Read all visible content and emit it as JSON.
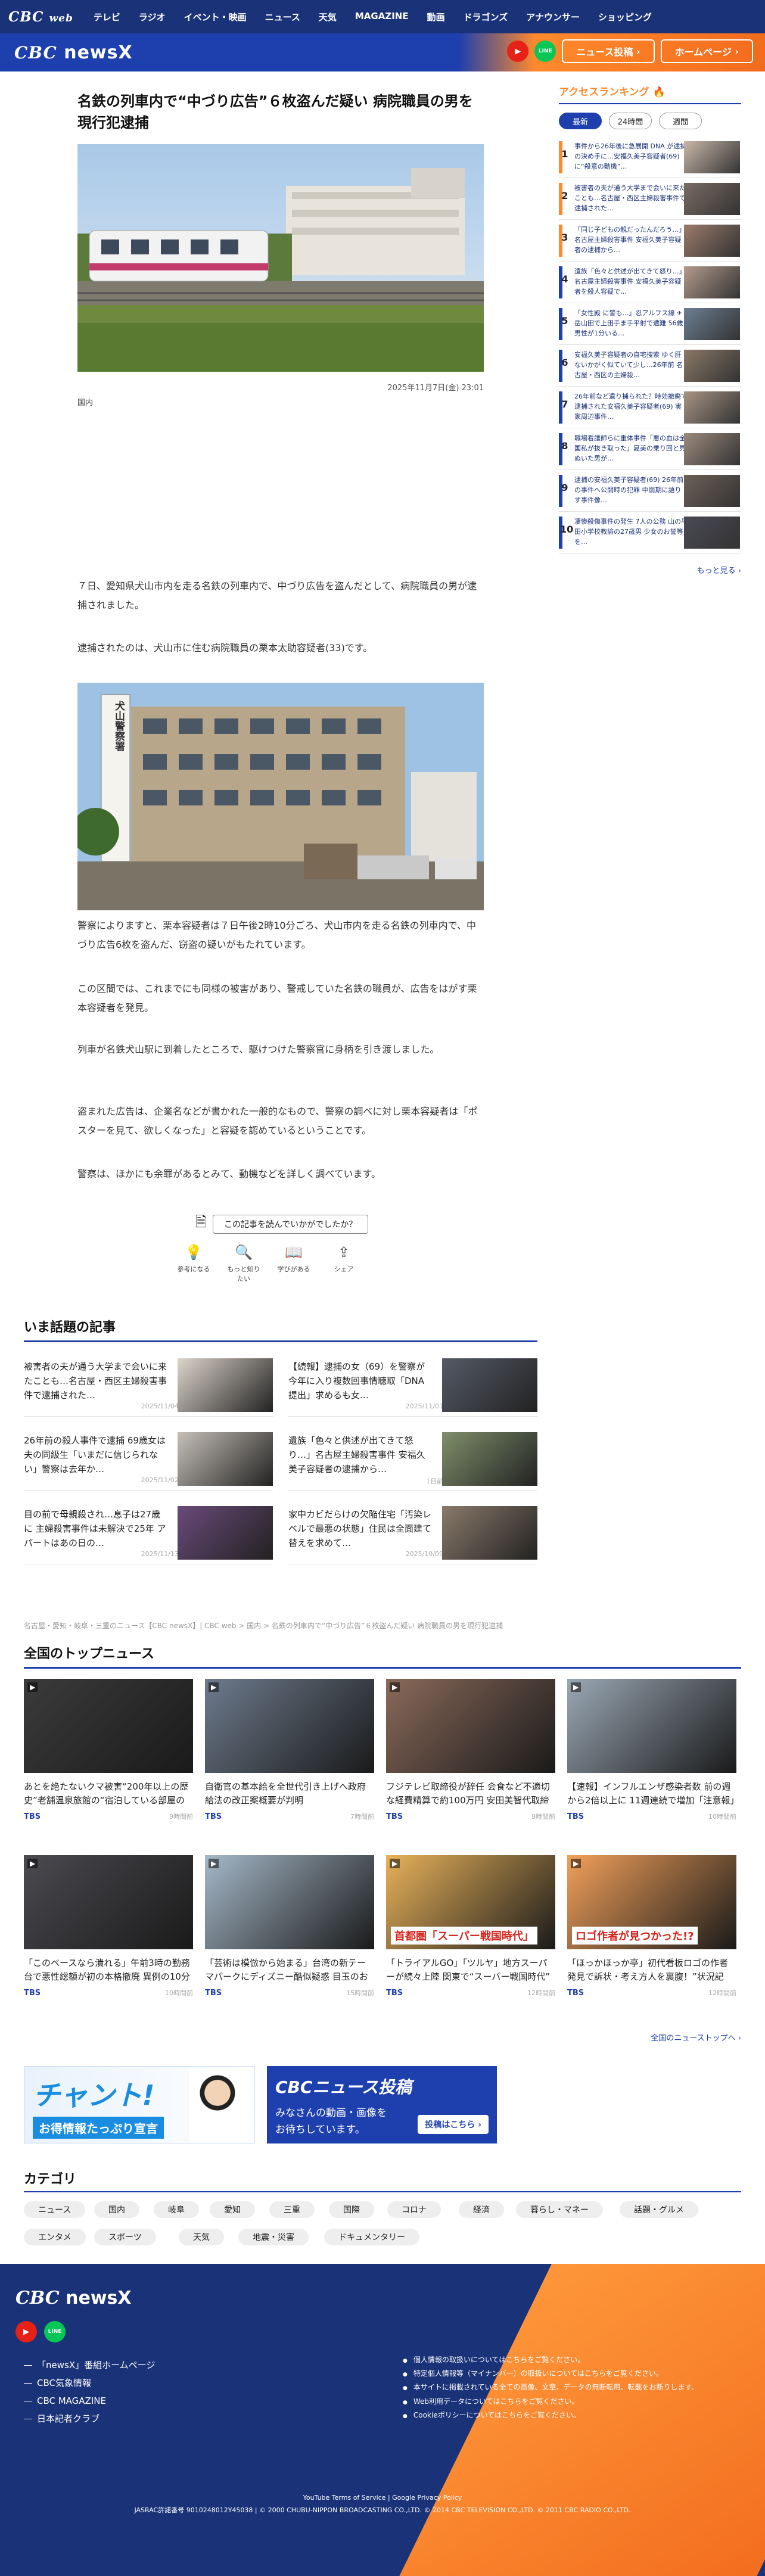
{
  "topnav": {
    "logo": "CBC",
    "logo_sub": "web",
    "items": [
      "テレビ",
      "ラジオ",
      "イベント・映画",
      "ニュース",
      "天気",
      "MAGAZINE",
      "動画",
      "ドラゴンズ",
      "アナウンサー",
      "ショッピング"
    ]
  },
  "brandbar": {
    "logo_a": "CBC",
    "logo_b": "newsX",
    "youtube": "▶",
    "line": "LINE",
    "post": "ニュース投稿",
    "home": "ホームページ"
  },
  "article": {
    "title": "名鉄の列車内で“中づり広告”６枚盗んだ疑い 病院職員の男を現行犯逮捕",
    "date": "2025年11月7日(金) 23:01",
    "category": "国内",
    "p1": "７日、愛知県犬山市内を走る名鉄の列車内で、中づり広告を盗んだとして、病院職員の男が逮捕されました。",
    "p2": "逮捕されたのは、犬山市に住む病院職員の栗本太助容疑者(33)です。",
    "p3": "警察によりますと、栗本容疑者は７日午後2時10分ごろ、犬山市内を走る名鉄の列車内で、中づり広告6枚を盗んだ、窃盗の疑いがもたれています。",
    "p4": "この区間では、これまでにも同様の被害があり、警戒していた名鉄の職員が、広告をはがす栗本容疑者を発見。",
    "p5": "列車が名鉄犬山駅に到着したところで、駆けつけた警察官に身柄を引き渡しました。",
    "p6": "盗まれた広告は、企業名などが書かれた一般的なもので、警察の調べに対し栗本容疑者は「ポスターを見て、欲しくなった」と容疑を認めているということです。",
    "p7": "警察は、ほかにも余罪があるとみて、動機などを詳しく調べています。",
    "sign": "犬山警察署"
  },
  "feedback": {
    "question": "この記事を読んでいかがでしたか？",
    "reactions": [
      "参考になる",
      "もっと知りたい",
      "学びがある",
      "シェア"
    ]
  },
  "ranking": {
    "title": "アクセスランキング",
    "tabs": [
      "最新",
      "24時間",
      "週間"
    ],
    "items": [
      {
        "n": "1",
        "t": "事件から26年後に急展開 DNA が逮捕の決め手に…安福久美子容疑者(69)に“殺意の動機”…",
        "c": "#ff8a2c"
      },
      {
        "n": "2",
        "t": "被害者の夫が通う大学まで会いに来たことも…名古屋・西区主婦殺害事件で逮捕された…",
        "c": "#ff8a2c"
      },
      {
        "n": "3",
        "t": "「同じ子どもの親だったんだろう…」名古屋主婦殺害事件 安福久美子容疑者の逮捕から…",
        "c": "#ff8a2c"
      },
      {
        "n": "4",
        "t": "遺族「色々と供述が出てきて怒り…」名古屋主婦殺害事件 安福久美子容疑者を殺人容疑で…",
        "c": "#1e3fae"
      },
      {
        "n": "5",
        "t": "「女性殿 に警も…」忍アルフス線 ✈ 岳山田で上田手ま手平射で遭難 56歳男性が1分いる…",
        "c": "#1e3fae"
      },
      {
        "n": "6",
        "t": "安福久美子容疑者の自宅捜索 ゆく肝ないかがく似ていて少し…26年前 名古屋・西区の主婦殺…",
        "c": "#1e3fae"
      },
      {
        "n": "7",
        "t": "26年前など遺り捕られた？時効撤廃で逮捕された安福久美子容疑者(69) 実家周辺事件…",
        "c": "#1e3fae"
      },
      {
        "n": "8",
        "t": "職場看護師らに重体事件「悪の血は全国私が抜き取った」夏美の乗り回と見ぬいた男が…",
        "c": "#1e3fae"
      },
      {
        "n": "9",
        "t": "逮捕の安福久美子容疑者(69) 26年前の事件へ公開時の犯罪 中崩期に語りす事件像…",
        "c": "#1e3fae"
      },
      {
        "n": "10",
        "t": "凄惨殺傷事件の発生 7人の公務 山の平田小学校教諭の27歳男 少女のお誉等を…",
        "c": "#1e3fae"
      }
    ],
    "more": "もっと見る ›"
  },
  "topics": {
    "title": "いま話題の記事",
    "items": [
      {
        "t": "被害者の夫が通う大学まで会いに来たことも…名古屋・西区主婦殺害事件で逮捕された…",
        "d": "2025/11/04"
      },
      {
        "t": "【続報】逮捕の女（69）を警察が今年に入り複数回事情聴取「DNA提出」求めるも女…",
        "d": "2025/11/01"
      },
      {
        "t": "26年前の殺人事件で逮捕 69歳女は夫の同級生「いまだに信じられない」警察は去年か…",
        "d": "2025/11/02"
      },
      {
        "t": "遺族「色々と供述が出てきて怒り…」名古屋主婦殺害事件 安福久美子容疑者の逮捕から…",
        "d": "1日前"
      },
      {
        "t": "目の前で母親殺され…息子は27歳に 主婦殺害事件は未解決で25年 アパートはあの日の…",
        "d": "2025/11/13"
      },
      {
        "t": "家中カビだらけの欠陥住宅「汚染レベルで最悪の状態」住民は全面建て替えを求めて…",
        "d": "2025/10/09"
      }
    ]
  },
  "breadcrumb": "名古屋・愛知・岐阜・三重のニュース【CBC newsX】| CBC web > 国内 > 名鉄の列車内で“中づり広告”６枚盗んだ疑い 病院職員の男を現行犯逮捕",
  "national": {
    "title": "全国のトップニュース",
    "items": [
      {
        "t": "あとを絶たないクマ被害“200年以上の歴史”老舗温泉旅館の“宿泊している部屋の前に…",
        "s": "TBS",
        "d": "9時間前"
      },
      {
        "t": "自衛官の基本給を全世代引き上げへ政府給法の改正案概要が判明",
        "s": "TBS",
        "d": "7時間前"
      },
      {
        "t": "フジテレビ取締役が辞任 会食など不適切な経費精算で約100万円 安田美智代取締役を事実を…",
        "s": "TBS",
        "d": "9時間前"
      },
      {
        "t": "【速報】インフルエンザ感染者数 前の週から2倍以上に 11週連続で増加「注意報」の基準を上回る 全国…",
        "s": "TBS",
        "d": "10時間前"
      },
      {
        "t": "「このベースなら潰れる」午前3時の勤務台で悪性総額が初の本格撤廃 異例の10分間休憩も政府側が要望 予…",
        "s": "TBS",
        "d": "10時間前"
      },
      {
        "t": "「芸術は模倣から始まる」台湾の新テーマパークにディズニー酷似疑惑 目玉のお城が“台湾版ディズニー”と話…",
        "s": "TBS",
        "d": "15時間前"
      },
      {
        "t": "「トライアルGO」「ツルヤ」地方スーパーが続々上陸 関東で“スーパー戦国時代” 生き残りのカギは「店の特…",
        "s": "TBS",
        "d": "12時間前"
      },
      {
        "t": "「ほっかほっか亭」初代看板ロゴの作者発見で訴状・考え方人を裏腹！”状況記載”に創業者の見解は【Nスタ解説】",
        "s": "TBS",
        "d": "12時間前"
      }
    ],
    "captions": [
      "",
      "",
      "",
      "",
      "",
      "",
      "首都圏「スーパー戦国時代」",
      "ロゴ作者が見つかった!?"
    ],
    "more": "全国のニューストップへ ›"
  },
  "banners": {
    "chant_a": "チャント!",
    "chant_b": "お得情報たっぷり宣言",
    "post_a": "CBCニュース投稿",
    "post_b": "みなさんの動画・画像を",
    "post_c": "お待ちしています。",
    "post_d": "投稿はこちら ›"
  },
  "categories": {
    "title": "カテゴリ",
    "row1": [
      "ニュース",
      "国内",
      "岐阜",
      "愛知",
      "三重",
      "国際",
      "コロナ",
      "経済",
      "暮らし・マネー",
      "話題・グルメ"
    ],
    "row2": [
      "エンタメ",
      "スポーツ",
      "天気",
      "地震・災害",
      "ドキュメンタリー"
    ]
  },
  "footer": {
    "logo_a": "CBC",
    "logo_b": "newsX",
    "links": [
      "「newsX」番組ホームページ",
      "CBC気象情報",
      "CBC MAGAZINE",
      "日本記者クラブ"
    ],
    "policy": [
      "個人情報の取扱いについてはこちらをご覧ください。",
      "特定個人情報等（マイナンバー）の取扱いについてはこちらをご覧ください。",
      "本サイトに掲載されている全ての画像、文章、データの無断転用、転載をお断りします。",
      "Web利用データについてはこちらをご覧ください。",
      "Cookieポリシーについてはこちらをご覧ください。"
    ],
    "youtube": "YouTube Terms of Service | Google Privacy Policy",
    "copyright": "JASRAC許諾番号 9010248012Y45038 | © 2000 CHUBU-NIPPON BROADCASTING CO.,LTD. © 2014 CBC TELEVISION CO.,LTD. © 2011 CBC RADIO CO.,LTD."
  }
}
